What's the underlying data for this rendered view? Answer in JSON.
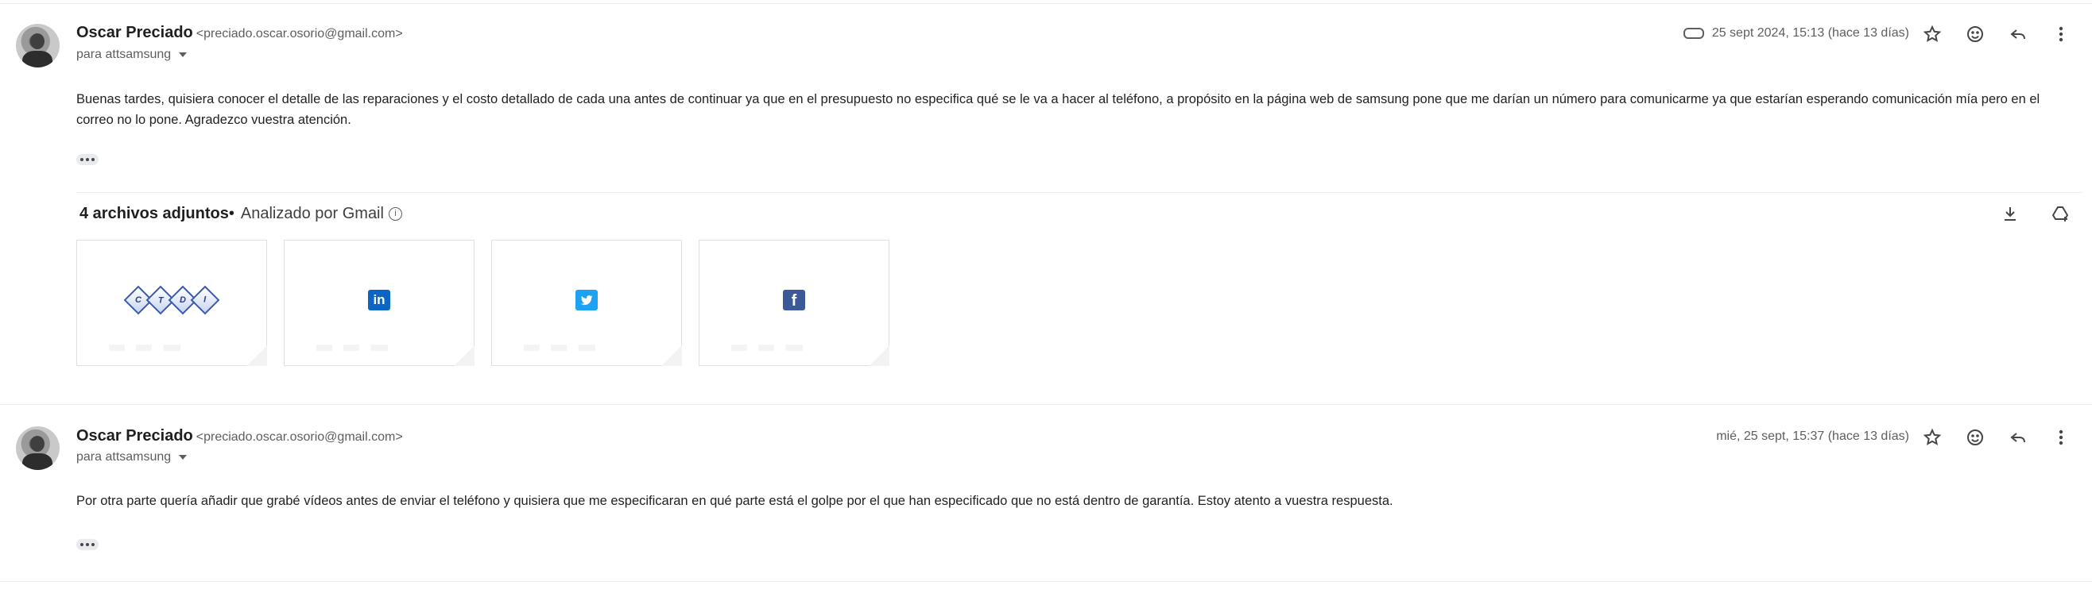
{
  "messages": [
    {
      "sender_name": "Oscar Preciado",
      "sender_email": "<preciado.oscar.osorio@gmail.com>",
      "to": "para attsamsung",
      "date": "25 sept 2024, 15:13 (hace 13 días)",
      "has_attachment_icon": true,
      "body": "Buenas tardes, quisiera conocer el detalle de las reparaciones y el costo detallado de cada una antes de continuar ya que en el presupuesto no especifica qué se le va a hacer al teléfono, a propósito en la página web de samsung pone que me darían un número para comunicarme ya que estarían esperando comunicación mía pero en el correo no lo pone. Agradezco vuestra atención.",
      "attachments_header": {
        "count_label": "4 archivos adjuntos",
        "separator": "•",
        "analyzed_label": "Analizado por Gmail"
      },
      "attachments": [
        {
          "icon": "ctdi-logo",
          "text": "CTDI",
          "letters": [
            "C",
            "T",
            "D",
            "I"
          ]
        },
        {
          "icon": "linkedin-icon",
          "text": "in",
          "color": "#0a66c2"
        },
        {
          "icon": "twitter-icon",
          "text": "",
          "color": "#1da1f2"
        },
        {
          "icon": "facebook-icon",
          "text": "f",
          "color": "#3b5998"
        }
      ]
    },
    {
      "sender_name": "Oscar Preciado",
      "sender_email": "<preciado.oscar.osorio@gmail.com>",
      "to": "para attsamsung",
      "date": "mié, 25 sept, 15:37 (hace 13 días)",
      "has_attachment_icon": false,
      "body": "Por otra parte quería añadir que grabé vídeos antes de enviar el teléfono y quisiera que me especificaran en qué parte está el golpe por el que han especificado que no está dentro de garantía. Estoy atento a vuestra respuesta."
    }
  ],
  "icons": [
    "star-icon",
    "emoji-icon",
    "reply-icon",
    "more-vert-icon",
    "download-icon",
    "add-to-drive-icon",
    "info-icon",
    "attachment-clip-icon"
  ]
}
